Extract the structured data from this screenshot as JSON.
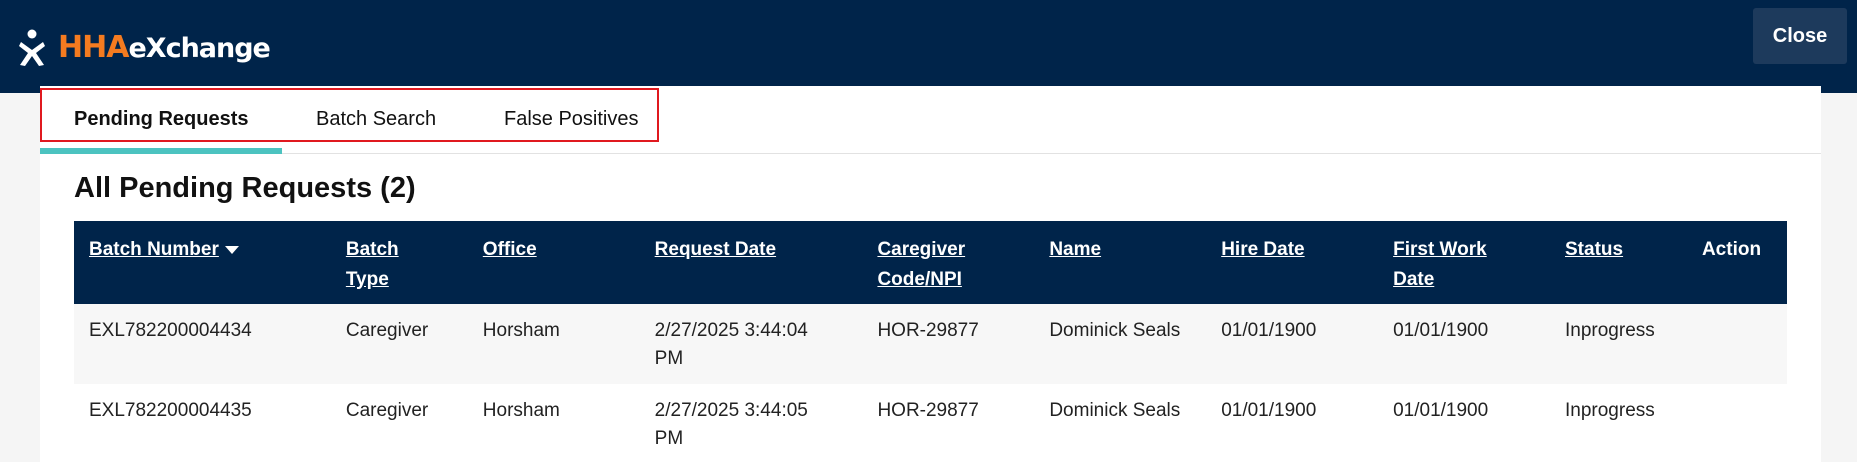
{
  "header": {
    "logo_hha": "HHA",
    "logo_exchange": "eXchange",
    "close_label": "Close"
  },
  "tabs": [
    {
      "label": "Pending Requests",
      "active": true
    },
    {
      "label": "Batch Search",
      "active": false
    },
    {
      "label": "False Positives",
      "active": false
    }
  ],
  "section_title": "All Pending Requests (2)",
  "table": {
    "columns": [
      {
        "line1": "Batch Number",
        "line2": ""
      },
      {
        "line1": "Batch",
        "line2": "Type"
      },
      {
        "line1": "Office",
        "line2": ""
      },
      {
        "line1": "Request Date",
        "line2": ""
      },
      {
        "line1": "Caregiver",
        "line2": "Code/NPI"
      },
      {
        "line1": "Name",
        "line2": ""
      },
      {
        "line1": "Hire Date",
        "line2": ""
      },
      {
        "line1": "First Work",
        "line2": "Date"
      },
      {
        "line1": "Status",
        "line2": ""
      },
      {
        "line1": "Action",
        "line2": ""
      }
    ],
    "rows": [
      {
        "batch_number": "EXL782200004434",
        "batch_type": "Caregiver",
        "office": "Horsham",
        "request_date_line1": "2/27/2025 3:44:04",
        "request_date_line2": "PM",
        "caregiver_code": "HOR-29877",
        "name": "Dominick Seals",
        "hire_date": "01/01/1900",
        "first_work_date": "01/01/1900",
        "status": "Inprogress",
        "action": ""
      },
      {
        "batch_number": "EXL782200004435",
        "batch_type": "Caregiver",
        "office": "Horsham",
        "request_date_line1": "2/27/2025 3:44:05",
        "request_date_line2": "PM",
        "caregiver_code": "HOR-29877",
        "name": "Dominick Seals",
        "hire_date": "01/01/1900",
        "first_work_date": "01/01/1900",
        "status": "Inprogress",
        "action": ""
      }
    ]
  },
  "colors": {
    "navy": "#00244a",
    "accent_orange": "#f47b20",
    "tab_underline": "#4cc3c0",
    "highlight_red": "#e0191f"
  },
  "icons": {
    "logo_mark": "person-figure-icon",
    "sort": "caret-down-icon"
  }
}
